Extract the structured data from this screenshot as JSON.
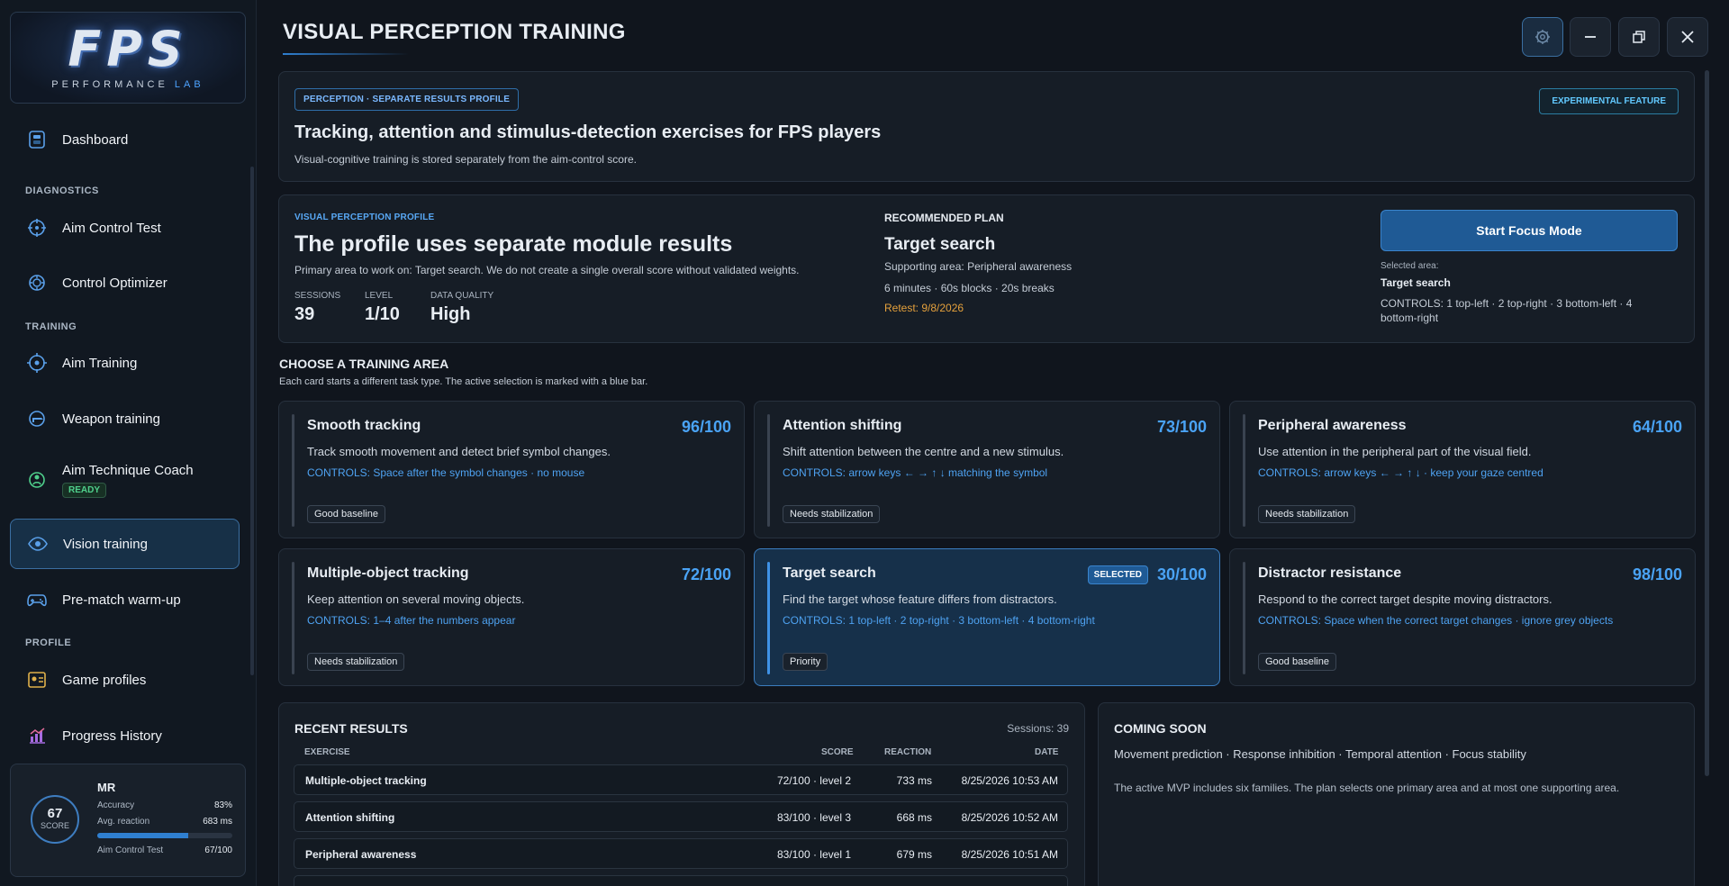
{
  "app": {
    "logo_text": "FPS",
    "logo_sub_a": "PERFORMANCE",
    "logo_sub_b": "LAB",
    "page_title": "VISUAL PERCEPTION TRAINING"
  },
  "sidebar": {
    "dashboard": "Dashboard",
    "sec_diagnostics": "DIAGNOSTICS",
    "aim_control_test": "Aim Control Test",
    "control_optimizer": "Control Optimizer",
    "sec_training": "TRAINING",
    "aim_training": "Aim Training",
    "weapon_training": "Weapon training",
    "aim_technique_coach": "Aim Technique Coach",
    "ready_badge": "READY",
    "vision_training": "Vision training",
    "pre_match": "Pre-match warm-up",
    "sec_profile": "PROFILE",
    "game_profiles": "Game profiles",
    "progress_history": "Progress History"
  },
  "user": {
    "score": "67",
    "score_label": "SCORE",
    "initials": "MR",
    "accuracy_label": "Accuracy",
    "accuracy_value": "83%",
    "reaction_label": "Avg. reaction",
    "reaction_value": "683 ms",
    "test_label": "Aim Control Test",
    "test_value": "67/100",
    "test_progress": 0.67
  },
  "banner": {
    "pill": "PERCEPTION · SEPARATE RESULTS PROFILE",
    "experimental": "EXPERIMENTAL FEATURE",
    "heading": "Tracking, attention and stimulus-detection exercises for FPS players",
    "subtext": "Visual-cognitive training is stored separately from the aim-control score."
  },
  "profile": {
    "label": "VISUAL PERCEPTION PROFILE",
    "heading": "The profile uses separate module results",
    "subtext": "Primary area to work on: Target search. We do not create a single overall score without validated weights.",
    "sessions_label": "SESSIONS",
    "sessions_value": "39",
    "level_label": "LEVEL",
    "level_value": "1/10",
    "quality_label": "DATA QUALITY",
    "quality_value": "High",
    "plan_label": "RECOMMENDED PLAN",
    "plan_area": "Target search",
    "plan_support": "Supporting area: Peripheral awareness",
    "plan_blocks": "6 minutes · 60s blocks · 20s breaks",
    "plan_retest": "Retest: 9/8/2026",
    "start_button": "Start Focus Mode",
    "selected_label": "Selected area:",
    "selected_value": "Target search",
    "selected_controls": "CONTROLS: 1 top-left · 2 top-right · 3 bottom-left · 4 bottom-right"
  },
  "areas": {
    "heading": "CHOOSE A TRAINING AREA",
    "subtext": "Each card starts a different task type. The active selection is marked with a blue bar.",
    "selected_badge": "SELECTED",
    "cards": [
      {
        "title": "Smooth tracking",
        "score": "96/100",
        "desc": "Track smooth movement and detect brief symbol changes.",
        "controls": "CONTROLS: Space after the symbol changes · no mouse",
        "tag": "Good baseline"
      },
      {
        "title": "Attention shifting",
        "score": "73/100",
        "desc": "Shift attention between the centre and a new stimulus.",
        "controls": "CONTROLS: arrow keys ← → ↑ ↓ matching the symbol",
        "tag": "Needs stabilization"
      },
      {
        "title": "Peripheral awareness",
        "score": "64/100",
        "desc": "Use attention in the peripheral part of the visual field.",
        "controls": "CONTROLS: arrow keys ← → ↑ ↓ · keep your gaze centred",
        "tag": "Needs stabilization"
      },
      {
        "title": "Multiple-object tracking",
        "score": "72/100",
        "desc": "Keep attention on several moving objects.",
        "controls": "CONTROLS: 1–4 after the numbers appear",
        "tag": "Needs stabilization"
      },
      {
        "title": "Target search",
        "score": "30/100",
        "desc": "Find the target whose feature differs from distractors.",
        "controls": "CONTROLS: 1 top-left · 2 top-right · 3 bottom-left · 4 bottom-right",
        "tag": "Priority"
      },
      {
        "title": "Distractor resistance",
        "score": "98/100",
        "desc": "Respond to the correct target despite moving distractors.",
        "controls": "CONTROLS: Space when the correct target changes · ignore grey objects",
        "tag": "Good baseline"
      }
    ]
  },
  "results": {
    "heading": "RECENT RESULTS",
    "sessions": "Sessions: 39",
    "col_exercise": "EXERCISE",
    "col_score": "SCORE",
    "col_reaction": "REACTION",
    "col_date": "DATE",
    "rows": [
      {
        "exercise": "Multiple-object tracking",
        "score": "72/100 · level 2",
        "reaction": "733 ms",
        "date": "8/25/2026 10:53 AM"
      },
      {
        "exercise": "Attention shifting",
        "score": "83/100 · level 3",
        "reaction": "668 ms",
        "date": "8/25/2026 10:52 AM"
      },
      {
        "exercise": "Peripheral awareness",
        "score": "83/100 · level 1",
        "reaction": "679 ms",
        "date": "8/25/2026 10:51 AM"
      }
    ]
  },
  "coming": {
    "heading": "COMING SOON",
    "list": "Movement prediction · Response inhibition · Temporal attention · Focus stability",
    "note": "The active MVP includes six families. The plan selects one primary area and at most one supporting area."
  },
  "colors": {
    "accent": "#2f7fd0",
    "selected": "#16304a",
    "score": "#4aa3f5",
    "ready": "#4fd08c",
    "retest": "#e5a13c"
  }
}
